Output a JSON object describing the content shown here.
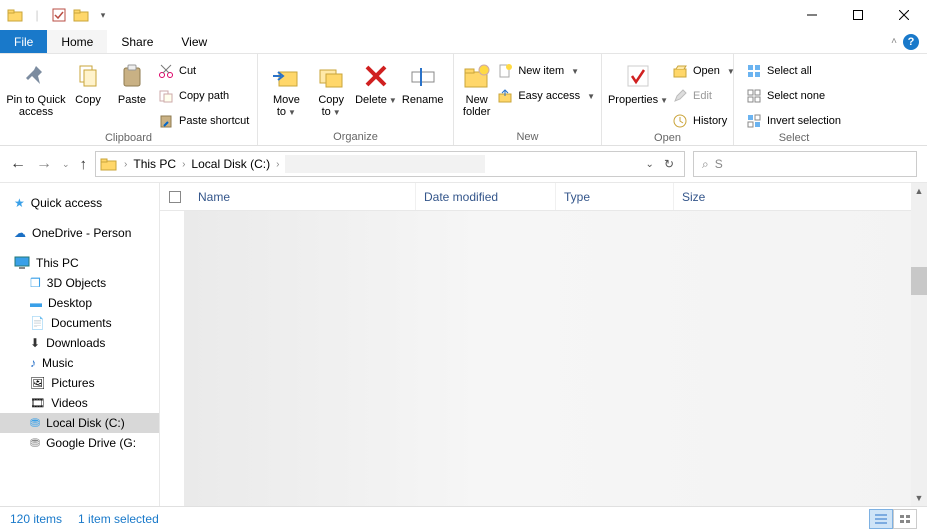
{
  "titlebar": {
    "qat_dropdown": "▾"
  },
  "tabs": {
    "file": "File",
    "home": "Home",
    "share": "Share",
    "view": "View"
  },
  "ribbon": {
    "clipboard": {
      "label": "Clipboard",
      "pin": "Pin to Quick access",
      "copy": "Copy",
      "paste": "Paste",
      "cut": "Cut",
      "copypath": "Copy path",
      "pasteshortcut": "Paste shortcut"
    },
    "organize": {
      "label": "Organize",
      "moveto": "Move to",
      "copyto": "Copy to",
      "delete": "Delete",
      "rename": "Rename"
    },
    "new": {
      "label": "New",
      "newfolder": "New folder",
      "newitem": "New item",
      "easyaccess": "Easy access"
    },
    "open": {
      "label": "Open",
      "properties": "Properties",
      "open": "Open",
      "edit": "Edit",
      "history": "History"
    },
    "select": {
      "label": "Select",
      "selectall": "Select all",
      "selectnone": "Select none",
      "invert": "Invert selection"
    }
  },
  "address": {
    "crumbs": [
      "This PC",
      "Local Disk (C:)"
    ],
    "search_placeholder": "S"
  },
  "columns": {
    "name": "Name",
    "modified": "Date modified",
    "type": "Type",
    "size": "Size"
  },
  "navpane": {
    "quickaccess": "Quick access",
    "onedrive": "OneDrive - Person",
    "thispc": "This PC",
    "children": [
      "3D Objects",
      "Desktop",
      "Documents",
      "Downloads",
      "Music",
      "Pictures",
      "Videos",
      "Local Disk (C:)",
      "Google Drive (G:"
    ]
  },
  "status": {
    "items": "120 items",
    "selected": "1 item selected"
  }
}
